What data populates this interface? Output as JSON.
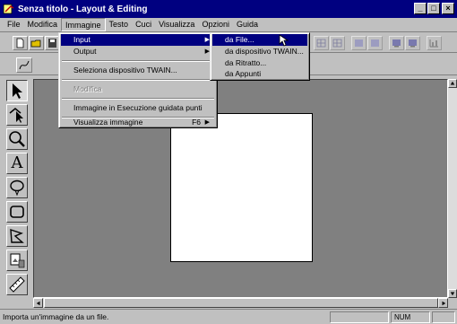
{
  "window": {
    "title": "Senza titolo - Layout & Editing",
    "buttons": {
      "minimize": "_",
      "maximize": "□",
      "close": "×"
    }
  },
  "menubar": {
    "items": [
      {
        "label": "File"
      },
      {
        "label": "Modifica"
      },
      {
        "label": "Immagine"
      },
      {
        "label": "Testo"
      },
      {
        "label": "Cuci"
      },
      {
        "label": "Visualizza"
      },
      {
        "label": "Opzioni"
      },
      {
        "label": "Guida"
      }
    ],
    "active": "Immagine"
  },
  "image_menu": {
    "items": [
      {
        "label": "Input",
        "submenu": true,
        "highlighted": true
      },
      {
        "label": "Output",
        "submenu": true
      },
      {
        "label": "Seleziona dispositivo TWAIN..."
      },
      {
        "label": "Modifica",
        "disabled": true
      },
      {
        "label": "Immagine in Esecuzione guidata punti"
      },
      {
        "label": "Visualizza immagine",
        "shortcut": "F6",
        "submenu": true
      }
    ]
  },
  "input_submenu": {
    "items": [
      {
        "label": "da File...",
        "highlighted": true
      },
      {
        "label": "da dispositivo TWAIN..."
      },
      {
        "label": "da Ritratto..."
      },
      {
        "label": "da Appunti"
      }
    ]
  },
  "tools": {
    "icons": [
      "select-arrow-icon",
      "node-edit-icon",
      "zoom-icon",
      "text-icon",
      "ellipse-icon",
      "rectangle-icon",
      "polygon-icon",
      "image-tool-icon",
      "ruler-icon"
    ],
    "text_glyph": "A"
  },
  "statusbar": {
    "message": "Importa un'immagine da un file.",
    "num": "NUM"
  },
  "colors": {
    "titlebar": "#000080",
    "face": "#c0c0c0",
    "workspace": "#808080",
    "highlight": "#000080"
  }
}
